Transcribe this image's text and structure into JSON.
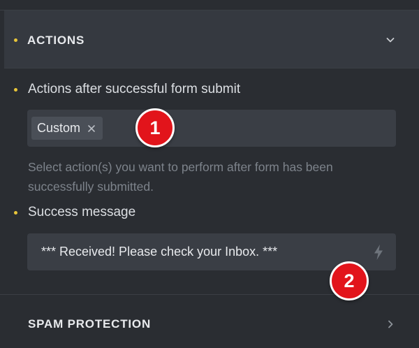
{
  "actions_section": {
    "title": "ACTIONS",
    "state": "expanded"
  },
  "actions_field": {
    "label": "Actions after successful form submit",
    "selected_tags": [
      {
        "label": "Custom"
      }
    ],
    "help_text": "Select action(s) you want to perform after form has been successfully submitted."
  },
  "success_field": {
    "label": "Success message",
    "value": "*** Received! Please check your Inbox. ***"
  },
  "spam_section": {
    "title": "SPAM PROTECTION",
    "state": "collapsed"
  },
  "annotations": [
    {
      "number": "1"
    },
    {
      "number": "2"
    }
  ],
  "colors": {
    "background": "#2a2d32",
    "header_background": "#353940",
    "field_background": "#3a3e45",
    "accent_dot": "#e8c53a",
    "badge_red": "#e2141b"
  },
  "icons": {
    "section_toggle": "chevron-down-icon",
    "section_expand": "chevron-right-icon",
    "tag_remove": "close-icon",
    "dynamic_data": "bolt-icon"
  }
}
